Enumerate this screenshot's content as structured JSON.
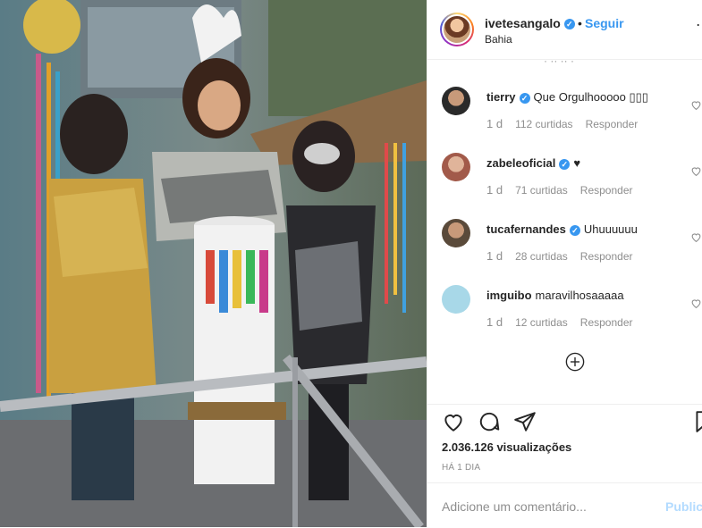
{
  "post": {
    "username": "ivetesangalo",
    "separator": "•",
    "follow_label": "Seguir",
    "location": "Bahia",
    "more_icon": "ellipsis-icon"
  },
  "comments": [
    {
      "user": "tierry",
      "verified": true,
      "text": "Que Orgulhooooo ▯▯▯",
      "time": "1 d",
      "likes": "112 curtidas",
      "reply": "Responder",
      "avatar_color": "#3a3a3a"
    },
    {
      "user": "zabeleoficial",
      "verified": true,
      "text": "♥",
      "time": "1 d",
      "likes": "71 curtidas",
      "reply": "Responder",
      "avatar_color": "#c9907a"
    },
    {
      "user": "tucafernandes",
      "verified": true,
      "text": "Uhuuuuuu",
      "time": "1 d",
      "likes": "28 curtidas",
      "reply": "Responder",
      "avatar_color": "#6a5a48"
    },
    {
      "user": "imguibo",
      "verified": false,
      "text": "maravilhosaaaaa",
      "time": "1 d",
      "likes": "12 curtidas",
      "reply": "Responder",
      "avatar_color": "#a8d8e8"
    }
  ],
  "stats": {
    "views": "2.036.126 visualizações",
    "time_ago": "HÁ 1 DIA"
  },
  "comment_form": {
    "placeholder": "Adicione um comentário...",
    "publish_label": "Publicar"
  },
  "colors": {
    "accent": "#3897f0",
    "text": "#262626",
    "muted": "#8e8e8e",
    "border": "#efefef"
  }
}
